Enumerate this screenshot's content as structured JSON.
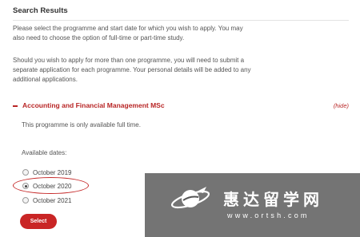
{
  "page": {
    "title": "Search Results",
    "intro": "Please select the programme and start date for which you wish to apply. You may also need to choose the option of full-time or part-time study.",
    "multi_note": "Should you wish to apply for more than one programme, you will need to submit a separate application for each programme. Your personal details will be added to any additional applications."
  },
  "programme": {
    "name": "Accounting and Financial Management MSc",
    "hide_label": "(hide)",
    "availability_note": "This programme is only available full time.",
    "dates_label": "Available dates:",
    "dates": [
      {
        "label": "October 2019",
        "checked": false
      },
      {
        "label": "October 2020",
        "checked": true
      },
      {
        "label": "October 2021",
        "checked": false
      }
    ],
    "select_label": "Select"
  },
  "watermark": {
    "name": "惠达留学网",
    "url": "www.ortsh.com"
  },
  "colors": {
    "accent": "#b82525",
    "button": "#c92525",
    "highlight_ring": "#c62a2a",
    "watermark_bg": "#555555"
  }
}
